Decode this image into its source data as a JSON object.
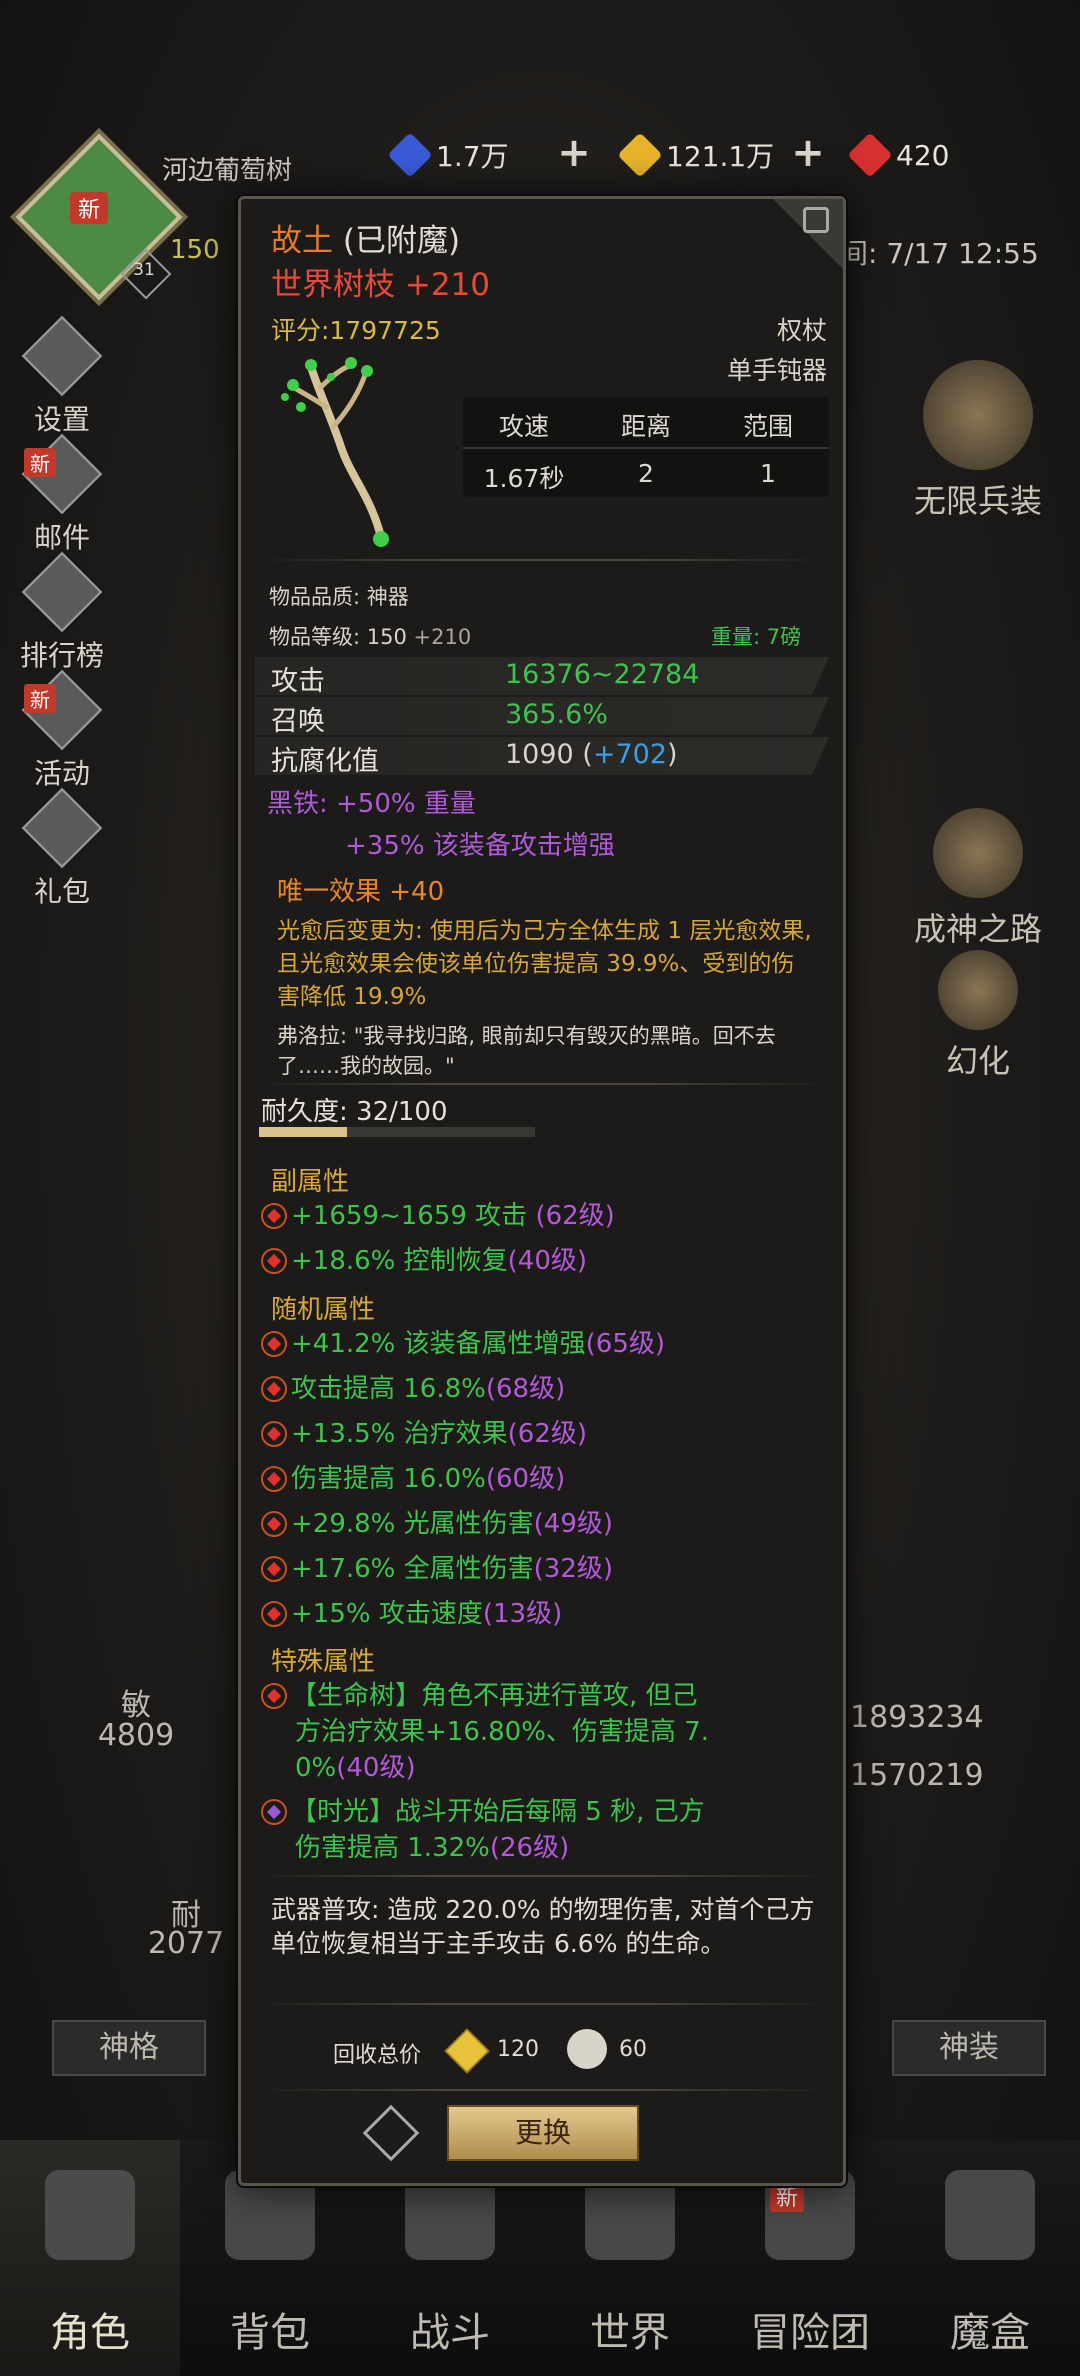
{
  "hud": {
    "player_name": "河边葡萄树",
    "avatar_tag": "新",
    "level_frag": "150",
    "level_badge": "31",
    "time_text": "间: 7/17 12:55",
    "resources": [
      {
        "name": "blue-crystal",
        "value": "1.7万",
        "color": "#3a5bd8"
      },
      {
        "name": "gold-crystal",
        "value": "121.1万",
        "color": "#e8b42a"
      },
      {
        "name": "red-crystal",
        "value": "420",
        "color": "#d83030"
      }
    ]
  },
  "left_menu": [
    {
      "label": "设置",
      "tag": ""
    },
    {
      "label": "邮件",
      "tag": "新"
    },
    {
      "label": "排行榜",
      "tag": ""
    },
    {
      "label": "活动",
      "tag": "新"
    },
    {
      "label": "礼包",
      "tag": ""
    }
  ],
  "right_menu": [
    {
      "label": "无限兵装"
    },
    {
      "label": "成神之路"
    },
    {
      "label": "幻化"
    }
  ],
  "bg_stats": {
    "left1_label": "敏",
    "left1_value": "4809",
    "left2_label": "耐",
    "left2_value": "2077",
    "right1": "1893234",
    "right2": "1570219"
  },
  "bg_buttons": {
    "left": "神格",
    "right": "神装"
  },
  "bottom_nav": [
    {
      "label": "角色",
      "active": true
    },
    {
      "label": "背包"
    },
    {
      "label": "战斗"
    },
    {
      "label": "世界"
    },
    {
      "label": "冒险团",
      "tag": "新"
    },
    {
      "label": "魔盒"
    }
  ],
  "item": {
    "enchant_name": "故土",
    "enchant_status": "(已附魔)",
    "name": "世界树枝 +210",
    "score": "评分:1797725",
    "type1": "权杖",
    "type2": "单手钝器",
    "table_headers": [
      "攻速",
      "距离",
      "范围"
    ],
    "table_values": [
      "1.67秒",
      "2",
      "1"
    ],
    "quality": "物品品质: 神器",
    "item_level": "物品等级: 150",
    "item_level_bonus": "+210",
    "weight": "重量: 7磅",
    "base_stats": [
      {
        "key": "攻击",
        "value": "16376~22784"
      },
      {
        "key": "召唤",
        "value": "365.6%"
      },
      {
        "key": "抗腐化值",
        "value": "1090 (",
        "bonus": "+702",
        ")": ")"
      }
    ],
    "black_iron_line1": "黑铁: +50% 重量",
    "black_iron_line2": "+35% 该装备攻击增强",
    "unique_title": "唯一效果 +40",
    "unique_desc": "光愈后变更为: 使用后为己方全体生成 1 层光愈效果, 且光愈效果会使该单位伤害提高 39.9%、受到的伤害降低 19.9%",
    "lore": "弗洛拉: \"我寻找归路, 眼前却只有毁灭的黑暗。回不去了……我的故园。\"",
    "durability": "耐久度: 32/100",
    "durability_ratio": 0.32,
    "sub_title": "副属性",
    "sub_attrs": [
      {
        "text": "+1659~1659 攻击 ",
        "lv": "(62级)"
      },
      {
        "text": "+18.6% 控制恢复",
        "lv": "(40级)"
      }
    ],
    "rand_title": "随机属性",
    "rand_attrs": [
      {
        "text": "+41.2% 该装备属性增强",
        "lv": "(65级)"
      },
      {
        "text": "攻击提高 16.8%",
        "lv": "(68级)"
      },
      {
        "text": "+13.5% 治疗效果",
        "lv": "(62级)"
      },
      {
        "text": "伤害提高 16.0%",
        "lv": "(60级)"
      },
      {
        "text": "+29.8% 光属性伤害",
        "lv": "(49级)"
      },
      {
        "text": "+17.6% 全属性伤害",
        "lv": "(32级)"
      },
      {
        "text": "+15% 攻击速度",
        "lv": "(13级)"
      }
    ],
    "special_title": "特殊属性",
    "special_1_a": "【生命树】角色不再进行普攻, 但己",
    "special_1_b": "方治疗效果+16.80%、伤害提高 7.",
    "special_1_c": "0%",
    "special_1_lv": "(40级)",
    "special_2_a": "【时光】战斗开始后每隔 5 秒, 己方",
    "special_2_b": "伤害提高 1.32%",
    "special_2_lv": "(26级)",
    "weapon_attack": "武器普攻: 造成 220.0% 的物理伤害, 对首个己方单位恢复相当于主手攻击 6.6% 的生命。",
    "recycle_label": "回收总价",
    "recycle_gold": "120",
    "recycle_other": "60",
    "swap_button": "更换"
  }
}
